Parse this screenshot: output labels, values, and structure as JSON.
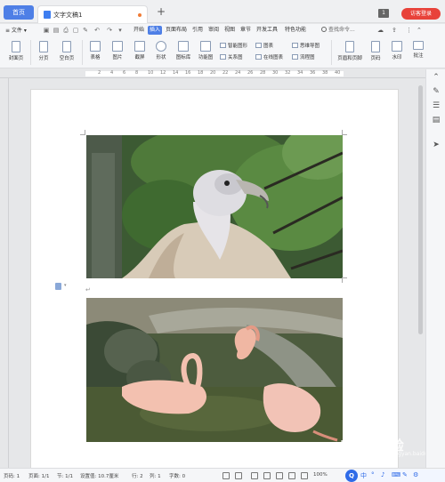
{
  "titlebar": {
    "home_tab": "首页",
    "doc_tab": "文字文稿1",
    "new_tab": "+",
    "badge": "1",
    "login": "访客登录"
  },
  "menubar": {
    "file": "≡ 文件 ▾",
    "tabs": [
      "开始",
      "插入",
      "页面布局",
      "引用",
      "审阅",
      "视图",
      "章节",
      "开发工具",
      "特色功能"
    ],
    "active_tab": "插入",
    "search": "查找命令..."
  },
  "ribbon": {
    "cover": "封面页",
    "page_break": "分页",
    "blank_page": "空白页",
    "table": "表格",
    "picture": "图片",
    "screenshot": "截屏",
    "shape": "形状",
    "icon_lib": "图标库",
    "function_chart": "功能图",
    "smart_shape": "智能图形",
    "chart": "图表",
    "mind_map": "思维导图",
    "relation": "关系图",
    "online_chart": "在线图表",
    "flowchart": "流程图",
    "header_footer": "页眉和页脚",
    "page_number": "页码",
    "watermark": "水印",
    "comment": "批注"
  },
  "ruler": [
    "2",
    "4",
    "6",
    "8",
    "10",
    "12",
    "14",
    "16",
    "18",
    "20",
    "22",
    "24",
    "26",
    "28",
    "30",
    "32",
    "34",
    "36",
    "38",
    "40"
  ],
  "document": {
    "paragraph_mark": "↵"
  },
  "statusbar": {
    "page": "页码: 1",
    "pages": "页面: 1/1",
    "section": "节: 1/1",
    "setting": "设置值: 10.7厘米",
    "row": "行: 2",
    "col": "列: 1",
    "words": "字数: 0",
    "zoom": "100%"
  },
  "ime": [
    "中",
    "°",
    "♪",
    "⌨",
    "✎",
    "⚙"
  ],
  "watermark_text": {
    "main": "Bai㊕经验",
    "sub": "jingyan.baidu.com"
  }
}
